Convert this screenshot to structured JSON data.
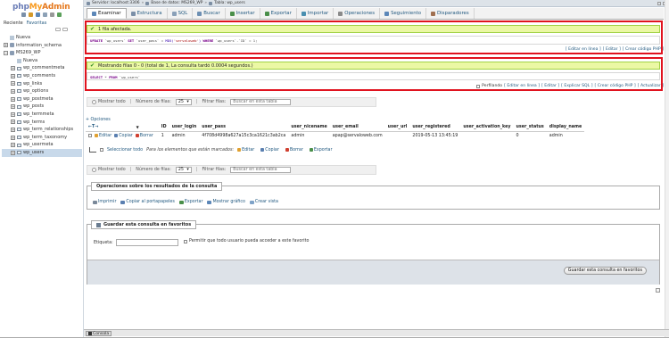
{
  "colors": {
    "accent_link": "#235a81",
    "success_bg": "#ebf8a4",
    "highlight_red": "#e0131f",
    "logo_php": "#6c7eb7",
    "logo_myadmin": "#f89a1e"
  },
  "logo": {
    "part1": "php",
    "part2": "My",
    "part3": "Admin"
  },
  "nav": {
    "tabs": [
      "Reciente",
      "Favoritas"
    ],
    "tree": [
      {
        "label": "Nueva",
        "level": 0,
        "icon": "new-icon"
      },
      {
        "label": "information_schema",
        "level": 0,
        "icon": "database-icon"
      },
      {
        "label": "MS269_WP",
        "level": 0,
        "icon": "database-icon"
      },
      {
        "label": "Nueva",
        "level": 1,
        "icon": "new-icon"
      },
      {
        "label": "wp_commentmeta",
        "level": 1,
        "icon": "table-icon"
      },
      {
        "label": "wp_comments",
        "level": 1,
        "icon": "table-icon"
      },
      {
        "label": "wp_links",
        "level": 1,
        "icon": "table-icon"
      },
      {
        "label": "wp_options",
        "level": 1,
        "icon": "table-icon"
      },
      {
        "label": "wp_postmeta",
        "level": 1,
        "icon": "table-icon"
      },
      {
        "label": "wp_posts",
        "level": 1,
        "icon": "table-icon"
      },
      {
        "label": "wp_termmeta",
        "level": 1,
        "icon": "table-icon"
      },
      {
        "label": "wp_terms",
        "level": 1,
        "icon": "table-icon"
      },
      {
        "label": "wp_term_relationships",
        "level": 1,
        "icon": "table-icon"
      },
      {
        "label": "wp_term_taxonomy",
        "level": 1,
        "icon": "table-icon"
      },
      {
        "label": "wp_usermeta",
        "level": 1,
        "icon": "table-icon"
      },
      {
        "label": "wp_users",
        "level": 1,
        "icon": "table-icon",
        "active": true
      }
    ]
  },
  "breadcrumb": {
    "server": "Servidor: localhost:3306",
    "database": "Base de datos: MS269_WP",
    "table": "Tabla: wp_users"
  },
  "tabs": [
    {
      "label": "Examinar",
      "icon": "browse-icon",
      "active": true
    },
    {
      "label": "Estructura",
      "icon": "structure-icon"
    },
    {
      "label": "SQL",
      "icon": "sql-icon"
    },
    {
      "label": "Buscar",
      "icon": "search-icon"
    },
    {
      "label": "Insertar",
      "icon": "insert-icon"
    },
    {
      "label": "Exportar",
      "icon": "export-icon"
    },
    {
      "label": "Importar",
      "icon": "import-icon"
    },
    {
      "label": "Operaciones",
      "icon": "wrench-icon"
    },
    {
      "label": "Seguimiento",
      "icon": "eye-icon"
    },
    {
      "label": "Disparadores",
      "icon": "trigger-icon"
    }
  ],
  "update_result": {
    "message": "1 fila afectada.",
    "sql_parts": {
      "k1": "UPDATE",
      "t1": "`wp_users`",
      "k2": "SET",
      "c1": "`user_pass`",
      "eq": "=",
      "fn": "MD5(",
      "s1": "'servaloweb'",
      "cp": ")",
      "k3": "WHERE",
      "c2": "`wp_users`.`ID`",
      "eq2": "=",
      "v": "1;"
    },
    "links": [
      "[ Editar en línea ]",
      "[ Editar ]",
      "[ Crear código PHP ]"
    ]
  },
  "select_result": {
    "message": "Mostrando filas 0 - 0 (total de 1, La consulta tardó 0.0004 segundos.)",
    "sql_parts": {
      "k1": "SELECT",
      "star": "*",
      "k2": "FROM",
      "t1": "`wp_users`"
    },
    "profiling_label": "Perfilando",
    "links": [
      "[ Editar en línea ]",
      "[ Editar ]",
      "[ Explicar SQL ]",
      "[ Crear código PHP ]",
      "[ Actualizar ]"
    ]
  },
  "navigation": {
    "show_all": "Mostrar todo",
    "rows_label": "Número de filas:",
    "rows_value": "25",
    "filter_label": "Filtrar filas:",
    "filter_placeholder": "Buscar en esta tabla"
  },
  "options_link": "+ Opciones",
  "table": {
    "arrows": "←T→",
    "columns": [
      "ID",
      "user_login",
      "user_pass",
      "user_nicename",
      "user_email",
      "user_url",
      "user_registered",
      "user_activation_key",
      "user_status",
      "display_name"
    ],
    "row_actions": [
      "Editar",
      "Copiar",
      "Borrar"
    ],
    "rows": [
      [
        "1",
        "admin",
        "4f708d4998a627a15c3ca1621c3ab2ca",
        "admin",
        "apap@servaloweb.com",
        "",
        "2019-05-13 13:45:19",
        "",
        "0",
        "admin"
      ]
    ]
  },
  "with_selected": {
    "select_all": "Seleccionar todo",
    "label": "Para los elementos que están marcados:",
    "actions": [
      "Editar",
      "Copiar",
      "Borrar",
      "Exportar"
    ]
  },
  "query_ops": {
    "legend": "Operaciones sobre los resultados de la consulta",
    "links": [
      "Imprimir",
      "Copiar al portapapeles",
      "Exportar",
      "Mostrar gráfico",
      "Crear vista"
    ]
  },
  "bookmark": {
    "legend": "Guardar esta consulta en favoritos",
    "label_field": "Etiqueta:",
    "shared_label": "Permitir que todo usuario pueda acceder a este favorito",
    "button": "Guardar esta consulta en favoritos"
  },
  "console": {
    "label": "Consola"
  }
}
